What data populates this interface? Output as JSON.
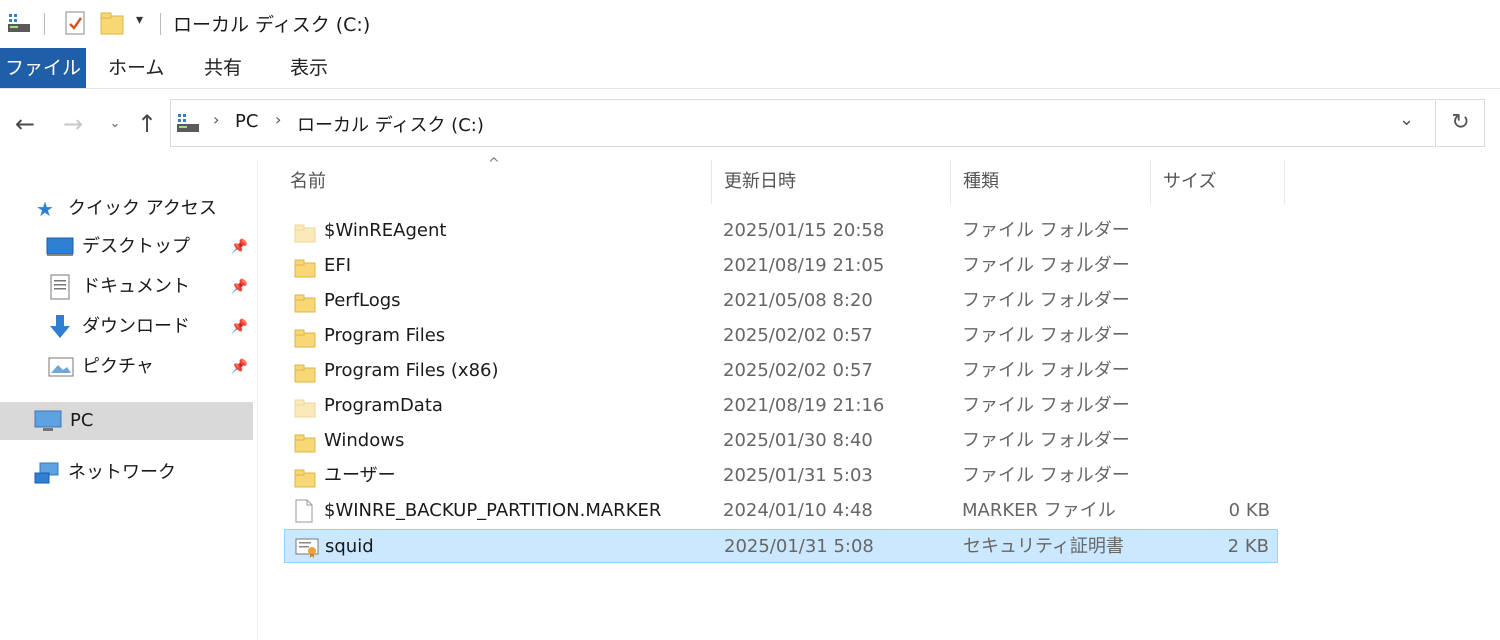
{
  "titlebar": {
    "title": "ローカル ディスク (C:)"
  },
  "ribbon": {
    "tabs": [
      "ファイル",
      "ホーム",
      "共有",
      "表示"
    ]
  },
  "address": {
    "segments": [
      "PC",
      "ローカル ディスク (C:)"
    ]
  },
  "sidebar": {
    "quick_access": "クイック アクセス",
    "pinned": [
      "デスクトップ",
      "ドキュメント",
      "ダウンロード",
      "ピクチャ"
    ],
    "pc": "PC",
    "network": "ネットワーク"
  },
  "columns": {
    "name": "名前",
    "date": "更新日時",
    "type": "種類",
    "size": "サイズ"
  },
  "files": [
    {
      "name": "$WinREAgent",
      "date": "2025/01/15 20:58",
      "type": "ファイル フォルダー",
      "size": "",
      "icon": "folder-light-icon"
    },
    {
      "name": "EFI",
      "date": "2021/08/19 21:05",
      "type": "ファイル フォルダー",
      "size": "",
      "icon": "folder-icon"
    },
    {
      "name": "PerfLogs",
      "date": "2021/05/08 8:20",
      "type": "ファイル フォルダー",
      "size": "",
      "icon": "folder-icon"
    },
    {
      "name": "Program Files",
      "date": "2025/02/02 0:57",
      "type": "ファイル フォルダー",
      "size": "",
      "icon": "folder-icon"
    },
    {
      "name": "Program Files (x86)",
      "date": "2025/02/02 0:57",
      "type": "ファイル フォルダー",
      "size": "",
      "icon": "folder-icon"
    },
    {
      "name": "ProgramData",
      "date": "2021/08/19 21:16",
      "type": "ファイル フォルダー",
      "size": "",
      "icon": "folder-light-icon"
    },
    {
      "name": "Windows",
      "date": "2025/01/30 8:40",
      "type": "ファイル フォルダー",
      "size": "",
      "icon": "folder-icon"
    },
    {
      "name": "ユーザー",
      "date": "2025/01/31 5:03",
      "type": "ファイル フォルダー",
      "size": "",
      "icon": "folder-icon"
    },
    {
      "name": "$WINRE_BACKUP_PARTITION.MARKER",
      "date": "2024/01/10 4:48",
      "type": "MARKER ファイル",
      "size": "0 KB",
      "icon": "file-icon"
    },
    {
      "name": "squid",
      "date": "2025/01/31 5:08",
      "type": "セキュリティ証明書",
      "size": "2 KB",
      "icon": "certificate-icon"
    }
  ],
  "colors": {
    "accent": "#1f5fa8",
    "selection": "#cce8ff",
    "folder": "#f8d775"
  }
}
